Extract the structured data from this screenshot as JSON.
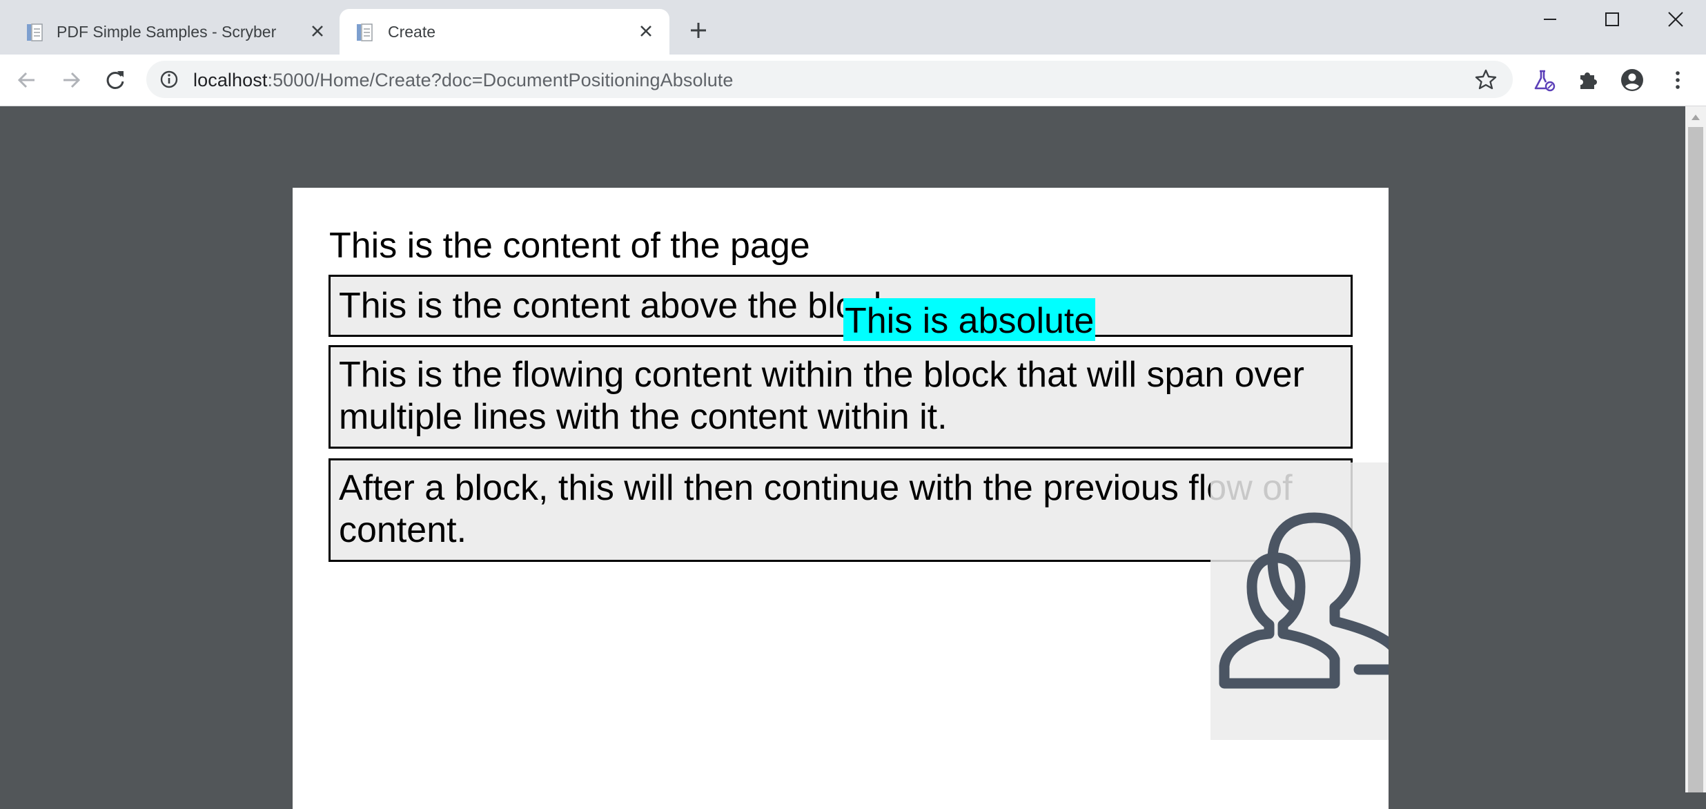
{
  "tabs": [
    {
      "title": "PDF Simple Samples - Scryber",
      "favicon": "document-icon"
    },
    {
      "title": "Create",
      "favicon": "document-icon",
      "active": true
    }
  ],
  "toolbar": {
    "url_host": "localhost",
    "url_rest": ":5000/Home/Create?doc=DocumentPositioningAbsolute"
  },
  "document": {
    "page_text": "This is the content of the page",
    "block_above": "This is the content above the block",
    "absolute_text": "This is absolute",
    "flowing_block": "This is the flowing content within the block that will span over multiple lines  with the content within it.",
    "after_block": "After a block, this will then continue with the previous flow of content.",
    "image_icon": "users-icon"
  },
  "colors": {
    "viewer_bg": "#525659",
    "absolute_highlight": "#00ffff",
    "block_bg": "#ededed"
  }
}
